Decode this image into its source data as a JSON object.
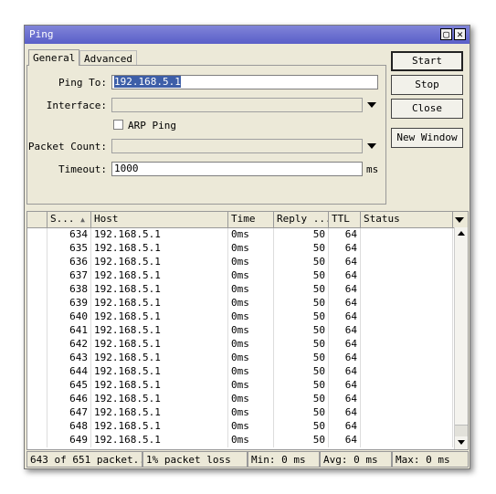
{
  "window": {
    "title": "Ping"
  },
  "tabs": [
    {
      "label": "General"
    },
    {
      "label": "Advanced"
    }
  ],
  "form": {
    "ping_to_label": "Ping To:",
    "ping_to_value": "192.168.5.1",
    "interface_label": "Interface:",
    "arp_ping_label": "ARP Ping",
    "packet_count_label": "Packet Count:",
    "timeout_label": "Timeout:",
    "timeout_value": "1000",
    "timeout_unit": "ms"
  },
  "buttons": {
    "start": "Start",
    "stop": "Stop",
    "close": "Close",
    "new_window": "New Window"
  },
  "table": {
    "columns": [
      "S...",
      "Host",
      "Time",
      "Reply ...",
      "TTL",
      "Status"
    ],
    "rows": [
      {
        "seq": "634",
        "host": "192.168.5.1",
        "time": "0ms",
        "reply": "50",
        "ttl": "64"
      },
      {
        "seq": "635",
        "host": "192.168.5.1",
        "time": "0ms",
        "reply": "50",
        "ttl": "64"
      },
      {
        "seq": "636",
        "host": "192.168.5.1",
        "time": "0ms",
        "reply": "50",
        "ttl": "64"
      },
      {
        "seq": "637",
        "host": "192.168.5.1",
        "time": "0ms",
        "reply": "50",
        "ttl": "64"
      },
      {
        "seq": "638",
        "host": "192.168.5.1",
        "time": "0ms",
        "reply": "50",
        "ttl": "64"
      },
      {
        "seq": "639",
        "host": "192.168.5.1",
        "time": "0ms",
        "reply": "50",
        "ttl": "64"
      },
      {
        "seq": "640",
        "host": "192.168.5.1",
        "time": "0ms",
        "reply": "50",
        "ttl": "64"
      },
      {
        "seq": "641",
        "host": "192.168.5.1",
        "time": "0ms",
        "reply": "50",
        "ttl": "64"
      },
      {
        "seq": "642",
        "host": "192.168.5.1",
        "time": "0ms",
        "reply": "50",
        "ttl": "64"
      },
      {
        "seq": "643",
        "host": "192.168.5.1",
        "time": "0ms",
        "reply": "50",
        "ttl": "64"
      },
      {
        "seq": "644",
        "host": "192.168.5.1",
        "time": "0ms",
        "reply": "50",
        "ttl": "64"
      },
      {
        "seq": "645",
        "host": "192.168.5.1",
        "time": "0ms",
        "reply": "50",
        "ttl": "64"
      },
      {
        "seq": "646",
        "host": "192.168.5.1",
        "time": "0ms",
        "reply": "50",
        "ttl": "64"
      },
      {
        "seq": "647",
        "host": "192.168.5.1",
        "time": "0ms",
        "reply": "50",
        "ttl": "64"
      },
      {
        "seq": "648",
        "host": "192.168.5.1",
        "time": "0ms",
        "reply": "50",
        "ttl": "64"
      },
      {
        "seq": "649",
        "host": "192.168.5.1",
        "time": "0ms",
        "reply": "50",
        "ttl": "64"
      }
    ]
  },
  "status": {
    "count": "643 of 651 packet...",
    "loss": "1% packet loss",
    "min": "Min: 0 ms",
    "avg": "Avg: 0 ms",
    "max": "Max: 0 ms"
  },
  "colors": {
    "titlebar": "#6468d0",
    "selection": "#3d5ea8",
    "background": "#ece9d8"
  }
}
